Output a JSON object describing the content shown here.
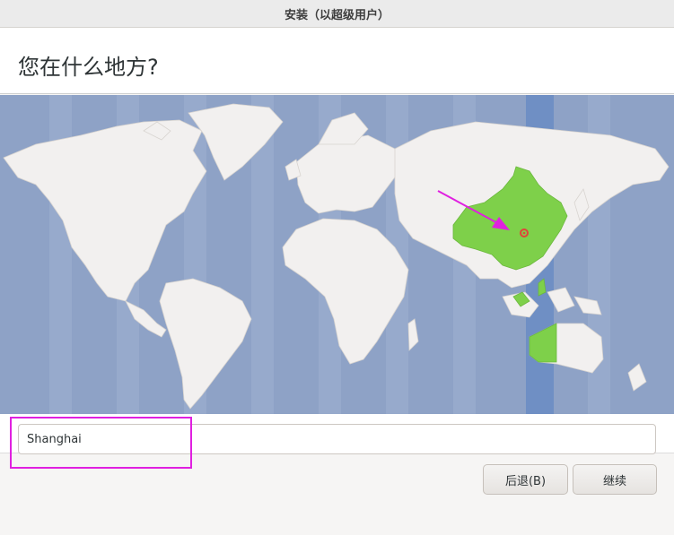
{
  "window": {
    "title": "安装（以超级用户）"
  },
  "page": {
    "title": "您在什么地方?"
  },
  "map": {
    "ocean_color": "#8ea2c6",
    "land_color": "#f2f0ef",
    "selected_region_color": "#7ed04a",
    "timezone_band_color": "#6f8fc4",
    "marker_color": "#e0443a",
    "annotation_color": "#e020e0",
    "selected_timezone": "Asia/Shanghai"
  },
  "location": {
    "value": "Shanghai",
    "placeholder": ""
  },
  "buttons": {
    "back_label": "后退(B)",
    "continue_label": "继续"
  }
}
